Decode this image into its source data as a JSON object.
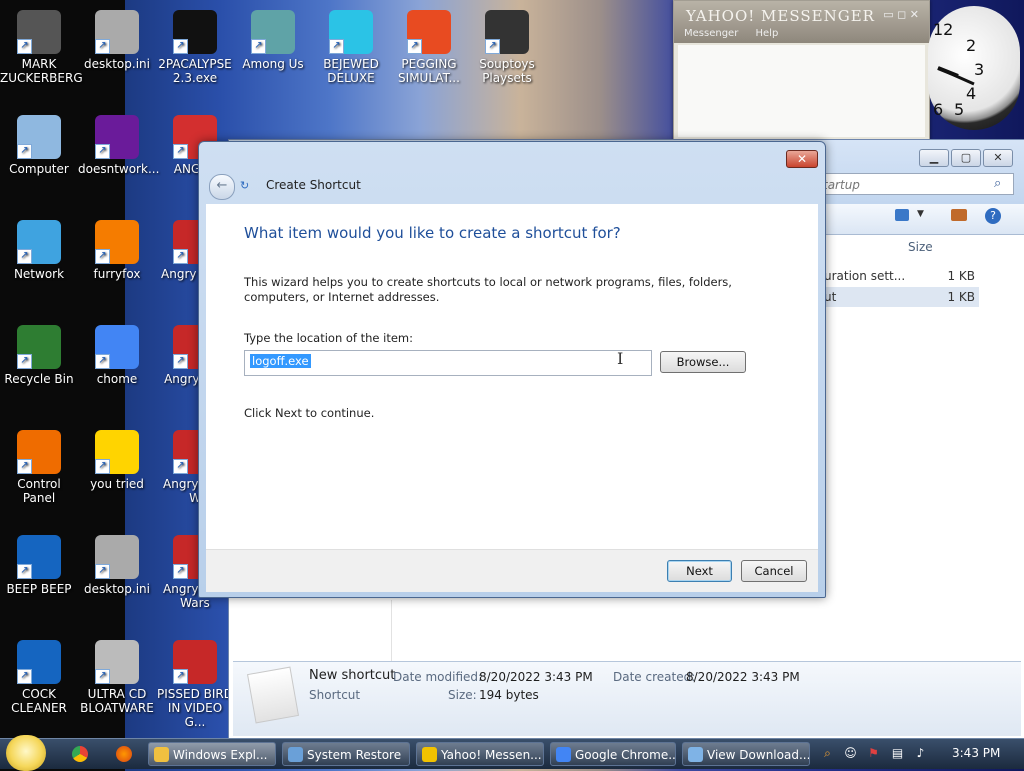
{
  "desktop": {
    "icons": [
      {
        "label": "MARK ZUCKERBERG",
        "color": "#555"
      },
      {
        "label": "desktop.ini",
        "color": "#aaa"
      },
      {
        "label": "2PACALYPSE 2.3.exe",
        "color": "#111"
      },
      {
        "label": "Among Us",
        "color": "#5fa3a7"
      },
      {
        "label": "BEJEWED DELUXE",
        "color": "#2bc3e6"
      },
      {
        "label": "PEGGING SIMULAT...",
        "color": "#e84b21"
      },
      {
        "label": "Souptoys Playsets",
        "color": "#333"
      },
      {
        "label": "Computer",
        "color": "#8fb8e0"
      },
      {
        "label": "doesntwork...",
        "color": "#6a1b9a"
      },
      {
        "label": "ANGER",
        "color": "#d32f2f"
      },
      {
        "label": "Network",
        "color": "#3fa3e0"
      },
      {
        "label": "furryfox",
        "color": "#f57c00"
      },
      {
        "label": "Angry Seas",
        "color": "#c62828"
      },
      {
        "label": "Recycle Bin",
        "color": "#2e7d32"
      },
      {
        "label": "chome",
        "color": "#4285f4"
      },
      {
        "label": "Angry Spa",
        "color": "#c62828"
      },
      {
        "label": "Control Panel",
        "color": "#ef6c00"
      },
      {
        "label": "you tried",
        "color": "#ffd400"
      },
      {
        "label": "Angry Star W",
        "color": "#c62828"
      },
      {
        "label": "BEEP BEEP",
        "color": "#1565c0"
      },
      {
        "label": "desktop.ini",
        "color": "#aaa"
      },
      {
        "label": "Angry Star Wars",
        "color": "#c62828"
      },
      {
        "label": "COCK CLEANER",
        "color": "#1565c0"
      },
      {
        "label": "ULTRA CD BLOATWARE",
        "color": "#bbb"
      },
      {
        "label": "PISSED BIRD IN VIDEO G...",
        "color": "#c62828"
      }
    ]
  },
  "yahoo": {
    "title": "YAHOO! MESSENGER",
    "menu_messenger": "Messenger",
    "menu_help": "Help"
  },
  "clock": {
    "n12": "12",
    "n2": "2",
    "n3": "3",
    "n4": "4",
    "n5": "5",
    "n6": "6"
  },
  "explorer": {
    "search_placeholder": "tartup",
    "column_size": "Size",
    "rows": [
      {
        "name": "uration sett...",
        "size": "1 KB"
      },
      {
        "name": "ut",
        "size": "1 KB"
      }
    ],
    "details": {
      "name": "New shortcut",
      "type": "Shortcut",
      "modified_label": "Date modified:",
      "modified_value": "8/20/2022 3:43 PM",
      "created_label": "Date created:",
      "created_value": "8/20/2022 3:43 PM",
      "size_label": "Size:",
      "size_value": "194 bytes"
    }
  },
  "dialog": {
    "close": "✕",
    "title": "Create Shortcut",
    "heading": "What item would you like to create a shortcut for?",
    "description": "This wizard helps you to create shortcuts to local or network programs, files, folders, computers, or Internet addresses.",
    "location_label": "Type the location of the item:",
    "location_value": "logoff.exe",
    "browse": "Browse...",
    "hint": "Click Next to continue.",
    "next": "Next",
    "cancel": "Cancel"
  },
  "taskbar": {
    "buttons": [
      {
        "label": "Windows Expl...",
        "color": "#f0c040"
      },
      {
        "label": "System Restore",
        "color": "#6aa0d8"
      },
      {
        "label": "Yahoo! Messen...",
        "color": "#f2c200"
      },
      {
        "label": "Google Chrome...",
        "color": "#4285f4"
      },
      {
        "label": "View Download...",
        "color": "#7fb3e6"
      }
    ],
    "time": "3:43 PM"
  }
}
